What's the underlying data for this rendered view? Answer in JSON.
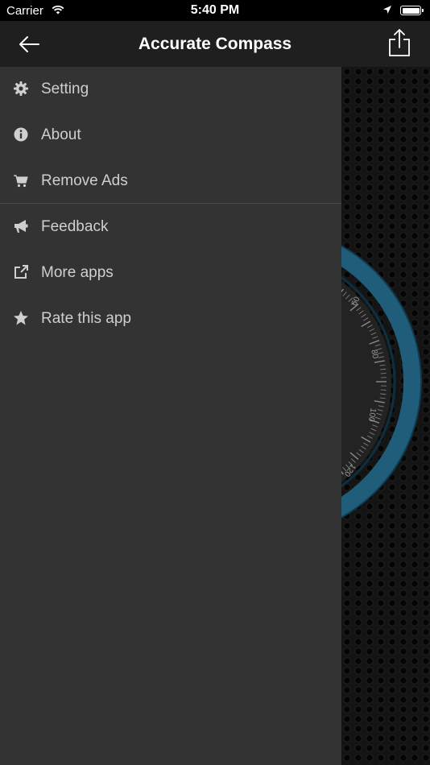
{
  "status_bar": {
    "carrier": "Carrier",
    "time": "5:40 PM"
  },
  "nav": {
    "title": "Accurate Compass"
  },
  "menu": {
    "items": [
      {
        "label": "Setting",
        "icon": "gear-icon"
      },
      {
        "label": "About",
        "icon": "info-icon"
      },
      {
        "label": "Remove Ads",
        "icon": "cart-icon"
      },
      {
        "label": "Feedback",
        "icon": "megaphone-icon"
      },
      {
        "label": "More apps",
        "icon": "external-link-icon"
      },
      {
        "label": "Rate this app",
        "icon": "star-icon"
      }
    ]
  },
  "compass": {
    "ticks": [
      "60",
      "80",
      "100",
      "120"
    ],
    "accent": "#1f5d7a"
  }
}
